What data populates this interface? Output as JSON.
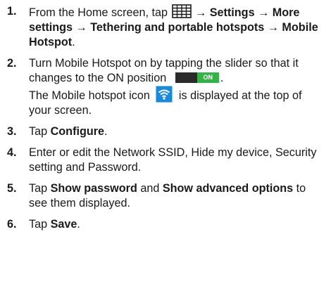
{
  "steps": [
    {
      "num": "1.",
      "seg": [
        "From the Home screen, tap",
        "→ Settings → More settings → Tethering and portable hotspots → Mobile Hotspot",
        "."
      ]
    },
    {
      "num": "2.",
      "seg": [
        "Turn Mobile Hotspot on by tapping the slider so that it changes to the ON position",
        "ON",
        ".",
        "The Mobile hotspot icon",
        "is displayed at the top of your screen."
      ]
    },
    {
      "num": "3.",
      "seg": [
        "Tap",
        "Configure",
        "."
      ]
    },
    {
      "num": "4.",
      "seg": [
        "Enter or edit the Network SSID, Hide my device, Security setting and Password."
      ]
    },
    {
      "num": "5.",
      "seg": [
        "Tap",
        "Show password",
        "and",
        "Show advanced options",
        "to see them displayed."
      ]
    },
    {
      "num": "6.",
      "seg": [
        "Tap",
        "Save",
        "."
      ]
    }
  ],
  "icons": [
    "apps-grid-icon",
    "toggle-switch",
    "wifi-hotspot-icon"
  ],
  "colors": {
    "toggle_on": "#35b24a",
    "toggle_track": "#2b2b2b",
    "hotspot_icon": "#1c8ad6"
  }
}
